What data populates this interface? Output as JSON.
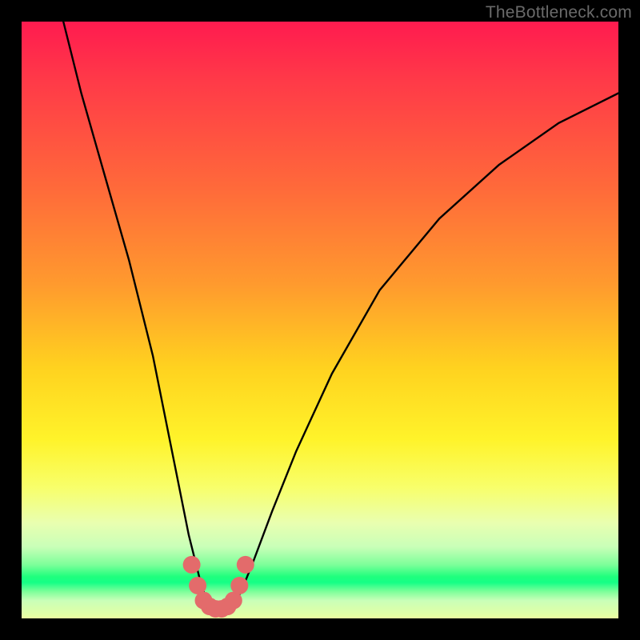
{
  "watermark": "TheBottleneck.com",
  "chart_data": {
    "type": "line",
    "title": "",
    "xlabel": "",
    "ylabel": "",
    "xlim": [
      0,
      100
    ],
    "ylim": [
      0,
      100
    ],
    "series": [
      {
        "name": "bottleneck-curve",
        "x": [
          7,
          10,
          14,
          18,
          22,
          26,
          28,
          30,
          31,
          32,
          33,
          34,
          35,
          36,
          37,
          39,
          42,
          46,
          52,
          60,
          70,
          80,
          90,
          100
        ],
        "y": [
          100,
          88,
          74,
          60,
          44,
          24,
          14,
          6,
          3,
          2,
          1.5,
          1.5,
          2,
          3,
          5,
          10,
          18,
          28,
          41,
          55,
          67,
          76,
          83,
          88
        ]
      }
    ],
    "markers": {
      "name": "highlight-points",
      "x": [
        28.5,
        29.5,
        30.5,
        31.5,
        32.5,
        33.5,
        34.5,
        35.5,
        36.5,
        37.5
      ],
      "y": [
        9,
        5.5,
        3,
        2,
        1.6,
        1.6,
        2,
        3,
        5.5,
        9
      ],
      "color": "#e36b6b",
      "radius_px": 11
    },
    "gradient_stops": [
      {
        "pos": 0.0,
        "color": "#ff1b4f"
      },
      {
        "pos": 0.44,
        "color": "#ff9a2e"
      },
      {
        "pos": 0.7,
        "color": "#fff32a"
      },
      {
        "pos": 0.93,
        "color": "#1fff7d"
      },
      {
        "pos": 1.0,
        "color": "#e9ffa0"
      }
    ]
  }
}
